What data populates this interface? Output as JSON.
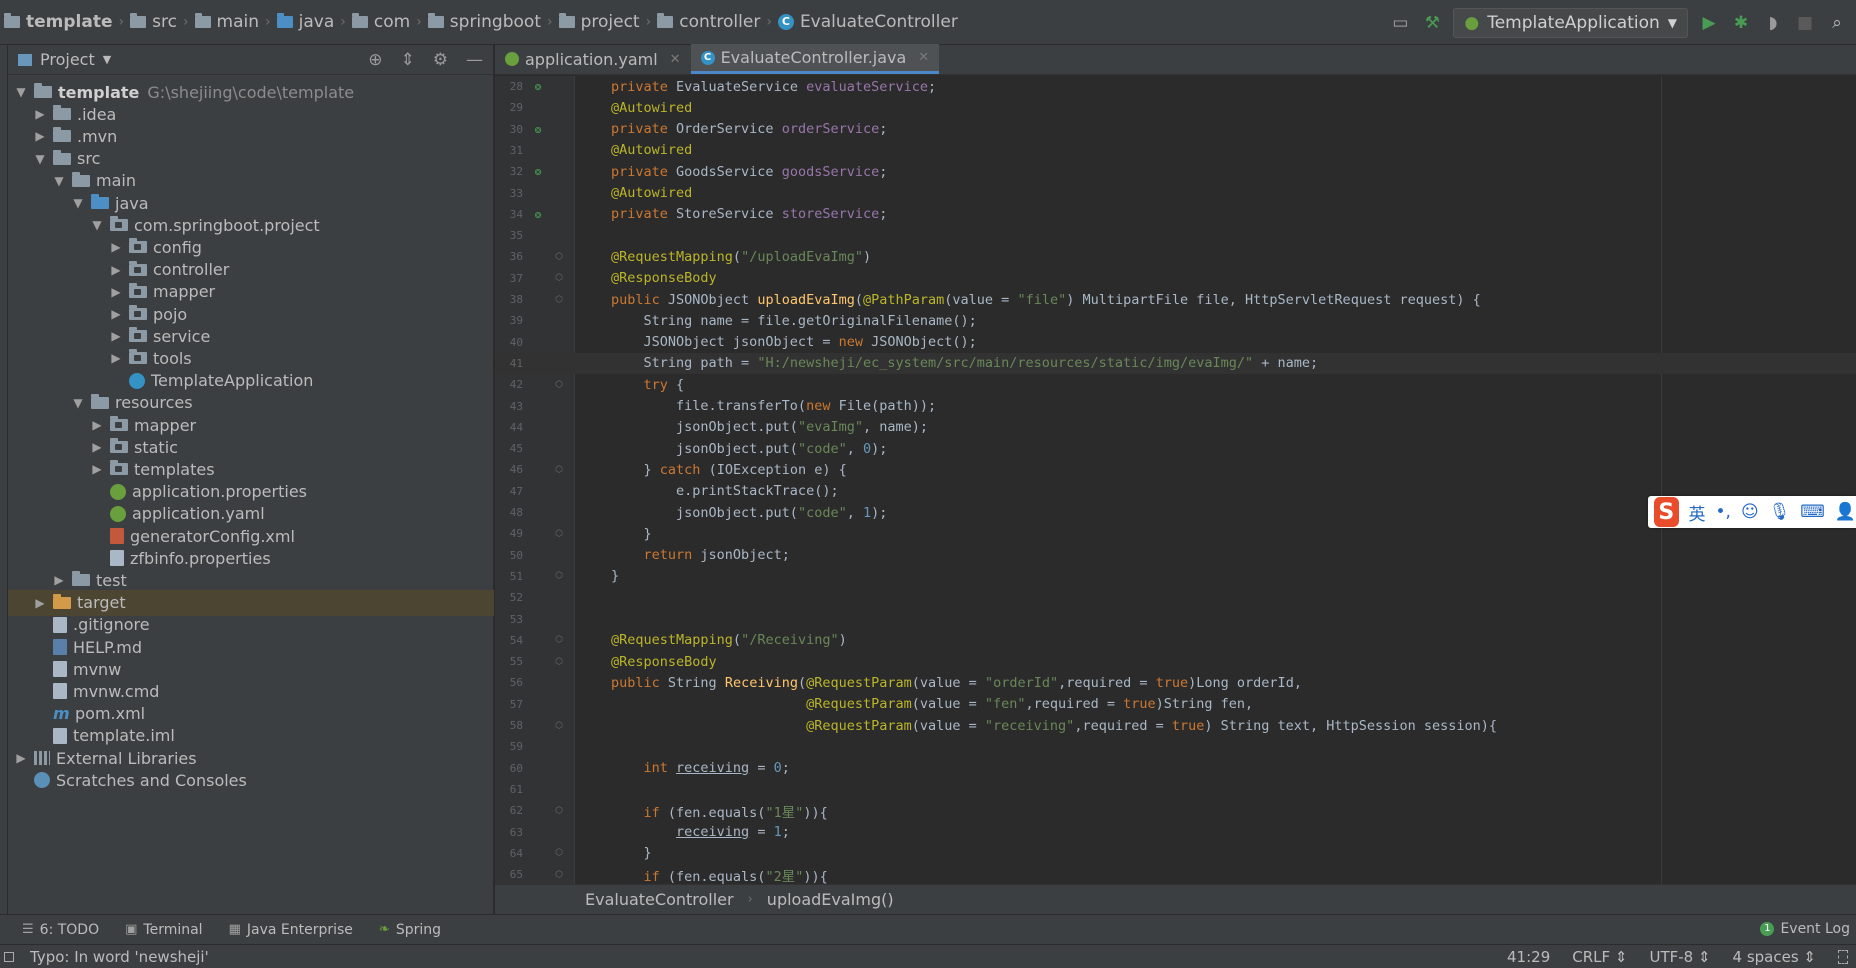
{
  "navbar": {
    "crumbs": [
      "template",
      "src",
      "main",
      "java",
      "com",
      "springboot",
      "project",
      "controller",
      "EvaluateController"
    ],
    "run_config": "TemplateApplication"
  },
  "project_panel": {
    "title": "Project",
    "tree": [
      {
        "label": "template",
        "path": "G:\\shejiing\\code\\template",
        "depth": 0,
        "arrow": "open",
        "icon": "folder-bold"
      },
      {
        "label": ".idea",
        "depth": 1,
        "arrow": "closed",
        "icon": "folder"
      },
      {
        "label": ".mvn",
        "depth": 1,
        "arrow": "closed",
        "icon": "folder"
      },
      {
        "label": "src",
        "depth": 1,
        "arrow": "open",
        "icon": "folder"
      },
      {
        "label": "main",
        "depth": 2,
        "arrow": "open",
        "icon": "folder"
      },
      {
        "label": "java",
        "depth": 3,
        "arrow": "open",
        "icon": "folder-blue"
      },
      {
        "label": "com.springboot.project",
        "depth": 4,
        "arrow": "open",
        "icon": "package"
      },
      {
        "label": "config",
        "depth": 5,
        "arrow": "closed",
        "icon": "package"
      },
      {
        "label": "controller",
        "depth": 5,
        "arrow": "closed",
        "icon": "package"
      },
      {
        "label": "mapper",
        "depth": 5,
        "arrow": "closed",
        "icon": "package"
      },
      {
        "label": "pojo",
        "depth": 5,
        "arrow": "closed",
        "icon": "package"
      },
      {
        "label": "service",
        "depth": 5,
        "arrow": "closed",
        "icon": "package"
      },
      {
        "label": "tools",
        "depth": 5,
        "arrow": "closed",
        "icon": "package"
      },
      {
        "label": "TemplateApplication",
        "depth": 5,
        "arrow": "none",
        "icon": "app-class"
      },
      {
        "label": "resources",
        "depth": 3,
        "arrow": "open",
        "icon": "folder-res"
      },
      {
        "label": "mapper",
        "depth": 4,
        "arrow": "closed",
        "icon": "package"
      },
      {
        "label": "static",
        "depth": 4,
        "arrow": "closed",
        "icon": "package"
      },
      {
        "label": "templates",
        "depth": 4,
        "arrow": "closed",
        "icon": "package"
      },
      {
        "label": "application.properties",
        "depth": 4,
        "arrow": "none",
        "icon": "spring"
      },
      {
        "label": "application.yaml",
        "depth": 4,
        "arrow": "none",
        "icon": "spring"
      },
      {
        "label": "generatorConfig.xml",
        "depth": 4,
        "arrow": "none",
        "icon": "xml"
      },
      {
        "label": "zfbinfo.properties",
        "depth": 4,
        "arrow": "none",
        "icon": "file"
      },
      {
        "label": "test",
        "depth": 2,
        "arrow": "closed",
        "icon": "folder"
      },
      {
        "label": "target",
        "depth": 1,
        "arrow": "closed",
        "icon": "folder-orange",
        "selected": true
      },
      {
        "label": ".gitignore",
        "depth": 1,
        "arrow": "none",
        "icon": "file"
      },
      {
        "label": "HELP.md",
        "depth": 1,
        "arrow": "none",
        "icon": "md"
      },
      {
        "label": "mvnw",
        "depth": 1,
        "arrow": "none",
        "icon": "file"
      },
      {
        "label": "mvnw.cmd",
        "depth": 1,
        "arrow": "none",
        "icon": "file"
      },
      {
        "label": "pom.xml",
        "depth": 1,
        "arrow": "none",
        "icon": "maven"
      },
      {
        "label": "template.iml",
        "depth": 1,
        "arrow": "none",
        "icon": "file"
      },
      {
        "label": "External Libraries",
        "depth": 0,
        "arrow": "closed",
        "icon": "libs"
      },
      {
        "label": "Scratches and Consoles",
        "depth": 0,
        "arrow": "none",
        "icon": "scratch"
      }
    ]
  },
  "editor": {
    "tabs": [
      {
        "label": "application.yaml",
        "active": false
      },
      {
        "label": "EvaluateController.java",
        "active": true
      }
    ],
    "current_line": 41,
    "lines": [
      {
        "n": 28,
        "mark": true,
        "html": "<span class='kw'>private </span>EvaluateService <span class='fld'>evaluateService</span>;"
      },
      {
        "n": 29,
        "html": "<span class='ann'>@Autowired</span>"
      },
      {
        "n": 30,
        "mark": true,
        "html": "<span class='kw'>private </span>OrderService <span class='fld'>orderService</span>;"
      },
      {
        "n": 31,
        "html": "<span class='ann'>@Autowired</span>"
      },
      {
        "n": 32,
        "mark": true,
        "html": "<span class='kw'>private </span>GoodsService <span class='fld'>goodsService</span>;"
      },
      {
        "n": 33,
        "html": "<span class='ann'>@Autowired</span>"
      },
      {
        "n": 34,
        "mark": true,
        "html": "<span class='kw'>private </span>StoreService <span class='fld'>storeService</span>;"
      },
      {
        "n": 35,
        "html": ""
      },
      {
        "n": 36,
        "fold": true,
        "html": "<span class='ann'>@RequestMapping</span>(<span class='str'>\"/uploadEvaImg\"</span>)"
      },
      {
        "n": 37,
        "fold": true,
        "html": "<span class='ann'>@ResponseBody</span>"
      },
      {
        "n": 38,
        "fold": true,
        "html": "<span class='kw'>public </span>JSONObject <span class='fn'>uploadEvaImg</span>(<span class='ann'>@PathParam</span>(value = <span class='str'>\"file\"</span>) MultipartFile file, HttpServletRequest request) {"
      },
      {
        "n": 39,
        "html": "    String name = file.getOriginalFilename();"
      },
      {
        "n": 40,
        "html": "    JSONObject jsonObject = <span class='kw'>new </span>JSONObject();"
      },
      {
        "n": 41,
        "html": "    String path = <span class='str'>\"H:/newsheji/ec_system/src/main/resources/static/img/evaImg/\"</span> + name;"
      },
      {
        "n": 42,
        "fold": true,
        "html": "    <span class='kw'>try </span>{"
      },
      {
        "n": 43,
        "html": "        file.transferTo(<span class='kw'>new </span>File(path));"
      },
      {
        "n": 44,
        "html": "        jsonObject.put(<span class='str'>\"evaImg\"</span>, name);"
      },
      {
        "n": 45,
        "html": "        jsonObject.put(<span class='str'>\"code\"</span>, <span class='num'>0</span>);"
      },
      {
        "n": 46,
        "fold": true,
        "html": "    } <span class='kw'>catch </span>(IOException e) {"
      },
      {
        "n": 47,
        "html": "        e.printStackTrace();"
      },
      {
        "n": 48,
        "html": "        jsonObject.put(<span class='str'>\"code\"</span>, <span class='num'>1</span>);"
      },
      {
        "n": 49,
        "fold": true,
        "html": "    }"
      },
      {
        "n": 50,
        "html": "    <span class='kw'>return </span>jsonObject;"
      },
      {
        "n": 51,
        "fold": true,
        "html": "}"
      },
      {
        "n": 52,
        "html": ""
      },
      {
        "n": 53,
        "html": ""
      },
      {
        "n": 54,
        "fold": true,
        "html": "<span class='ann'>@RequestMapping</span>(<span class='str'>\"/Receiving\"</span>)"
      },
      {
        "n": 55,
        "fold": true,
        "html": "<span class='ann'>@ResponseBody</span>"
      },
      {
        "n": 56,
        "html": "<span class='kw'>public </span>String <span class='fn'>Receiving</span>(<span class='ann'>@RequestParam</span>(value = <span class='str'>\"orderId\"</span>,required = <span class='kw'>true</span>)Long orderId,"
      },
      {
        "n": 57,
        "html": "                        <span class='ann'>@RequestParam</span>(value = <span class='str'>\"fen\"</span>,required = <span class='kw'>true</span>)String fen,"
      },
      {
        "n": 58,
        "fold": true,
        "html": "                        <span class='ann'>@RequestParam</span>(value = <span class='str'>\"receiving\"</span>,required = <span class='kw'>true</span>) String text, HttpSession session){"
      },
      {
        "n": 59,
        "html": ""
      },
      {
        "n": 60,
        "html": "    <span class='kw'>int </span><span class='ul'>receiving</span> = <span class='num'>0</span>;"
      },
      {
        "n": 61,
        "html": ""
      },
      {
        "n": 62,
        "fold": true,
        "html": "    <span class='kw'>if </span>(fen.equals(<span class='str'>\"1星\"</span>)){"
      },
      {
        "n": 63,
        "html": "        <span class='ul'>receiving</span> = <span class='num'>1</span>;"
      },
      {
        "n": 64,
        "fold": true,
        "html": "    }"
      },
      {
        "n": 65,
        "fold": true,
        "html": "    <span class='kw'>if </span>(fen.equals(<span class='str'>\"2星\"</span>)){"
      }
    ],
    "breadcrumb": [
      "EvaluateController",
      "uploadEvaImg()"
    ]
  },
  "ime": {
    "lang": "英",
    "punct": "•,"
  },
  "tool_windows": [
    {
      "label": "6: TODO",
      "icon": "list-icon"
    },
    {
      "label": "Terminal",
      "icon": "terminal-icon"
    },
    {
      "label": "Java Enterprise",
      "icon": "java-enterprise-icon"
    },
    {
      "label": "Spring",
      "icon": "spring-icon"
    }
  ],
  "event_log": {
    "label": "Event Log",
    "count": "1"
  },
  "status": {
    "message": "Typo: In word 'newsheji'",
    "position": "41:29",
    "line_sep": "CRLF ⇕",
    "encoding": "UTF-8 ⇕",
    "indent": "4 spaces ⇕"
  }
}
